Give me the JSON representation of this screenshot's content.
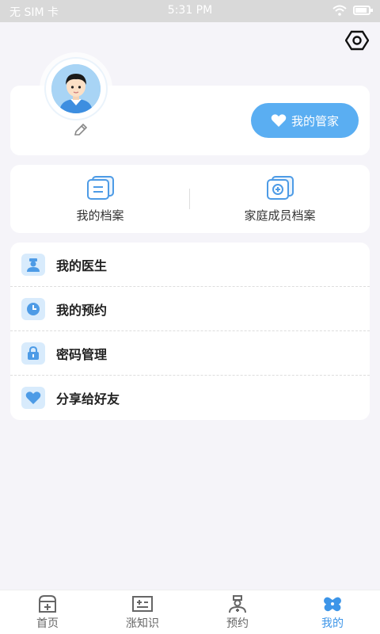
{
  "status_bar": {
    "carrier": "无 SIM 卡",
    "time": "5:31 PM"
  },
  "header": {
    "settings_icon": "gear-icon"
  },
  "profile": {
    "butler_label": "我的管家",
    "edit_icon": "pencil-icon",
    "avatar_icon": "avatar-boy"
  },
  "archives": [
    {
      "label": "我的档案",
      "icon": "document-stack-icon"
    },
    {
      "label": "家庭成员档案",
      "icon": "medical-stack-icon"
    }
  ],
  "menu": [
    {
      "label": "我的医生",
      "icon": "doctor-icon"
    },
    {
      "label": "我的预约",
      "icon": "clock-icon"
    },
    {
      "label": "密码管理",
      "icon": "lock-icon"
    },
    {
      "label": "分享给好友",
      "icon": "heart-icon"
    }
  ],
  "tabs": [
    {
      "label": "首页",
      "icon": "hospital-icon",
      "active": false
    },
    {
      "label": "涨知识",
      "icon": "knowledge-icon",
      "active": false
    },
    {
      "label": "预约",
      "icon": "doctor-icon",
      "active": false
    },
    {
      "label": "我的",
      "icon": "bandage-icon",
      "active": true
    }
  ],
  "colors": {
    "accent": "#5aaef2",
    "active_tab": "#3d95e8",
    "icon_bg": "#d8ebfc",
    "background": "#f5f4f9"
  }
}
